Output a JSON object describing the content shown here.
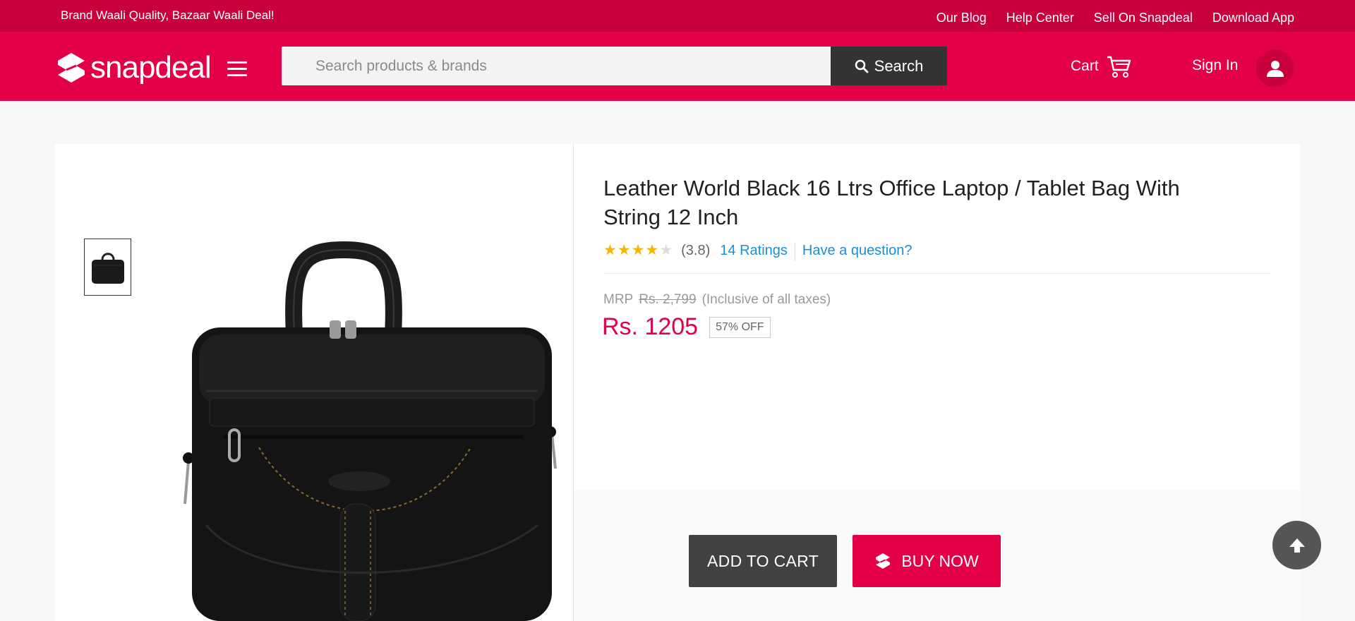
{
  "topbar": {
    "tagline": "Brand Waali Quality, Bazaar Waali Deal!",
    "links": [
      "Our Blog",
      "Help Center",
      "Sell On Snapdeal",
      "Download App"
    ]
  },
  "header": {
    "logo_text": "snapdeal",
    "search_placeholder": "Search products & brands",
    "search_button": "Search",
    "cart_label": "Cart",
    "signin_label": "Sign In"
  },
  "product": {
    "title": "Leather World Black 16 Ltrs Office Laptop / Tablet Bag With String 12 Inch",
    "rating_stars": 3.8,
    "rating_value": "(3.8)",
    "ratings_link": "14 Ratings",
    "question_link": "Have a question?",
    "mrp_label": "MRP",
    "mrp_value": "Rs. 2,799",
    "tax_note": "(Inclusive of all taxes)",
    "price": "Rs. 1205",
    "discount": "57% OFF"
  },
  "actions": {
    "add_to_cart": "ADD TO CART",
    "buy_now": "BUY NOW"
  },
  "colors": {
    "brand": "#e40046",
    "brand_dark": "#c8003b",
    "link": "#1b8fd6",
    "star": "#f7b500"
  },
  "icons": [
    "snapdeal-logo-icon",
    "menu-icon",
    "search-icon",
    "cart-icon",
    "user-icon",
    "scroll-top-icon"
  ]
}
